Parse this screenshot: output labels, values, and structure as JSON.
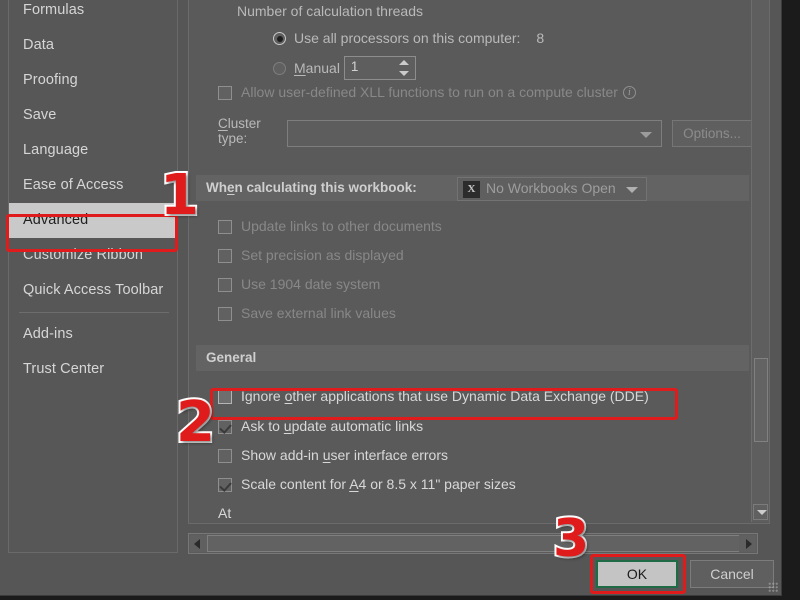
{
  "dialog": {
    "nav": {
      "items": [
        {
          "label": "Formulas",
          "selected": false
        },
        {
          "label": "Data",
          "selected": false
        },
        {
          "label": "Proofing",
          "selected": false
        },
        {
          "label": "Save",
          "selected": false
        },
        {
          "label": "Language",
          "selected": false
        },
        {
          "label": "Ease of Access",
          "selected": false
        },
        {
          "label": "Advanced",
          "selected": true
        },
        {
          "label": "Customize Ribbon",
          "selected": false
        },
        {
          "label": "Quick Access Toolbar",
          "selected": false
        },
        {
          "label": "Add-ins",
          "selected": false
        },
        {
          "label": "Trust Center",
          "selected": false
        }
      ]
    },
    "formulas_section": {
      "threads_label": "Number of calculation threads",
      "use_all_processors_label": "Use all processors on this computer:",
      "use_all_processors_count": "8",
      "use_all_processors_selected": true,
      "manual_label": "Manual",
      "manual_selected": false,
      "manual_value": "1",
      "allow_xll_label": "Allow user-defined XLL functions to run on a compute cluster",
      "allow_xll_checked": false,
      "info_icon": "info-circle-icon",
      "cluster_type_label_line1": "Cluster",
      "cluster_type_label_line2": "type:",
      "cluster_type_value": "",
      "options_button_label": "Options..."
    },
    "workbook_section": {
      "header": "When calculating this workbook:",
      "workbook_selector_value": "No Workbooks Open",
      "workbook_icon": "excel-file-icon",
      "checkboxes": [
        {
          "label": "Update links to other documents",
          "checked": false
        },
        {
          "label": "Set precision as displayed",
          "checked": false
        },
        {
          "label": "Use 1904 date system",
          "checked": false
        },
        {
          "label": "Save external link values",
          "checked": false
        }
      ]
    },
    "general_section": {
      "header": "General",
      "checkboxes": [
        {
          "label": "Ignore other applications that use Dynamic Data Exchange (DDE)",
          "checked": false,
          "highlighted": true
        },
        {
          "label": "Ask to update automatic links",
          "checked": true,
          "highlighted": false
        },
        {
          "label": "Show add-in user interface errors",
          "checked": false,
          "highlighted": false
        },
        {
          "label": "Scale content for A4 or 8.5 x 11\" paper sizes",
          "checked": true,
          "highlighted": false
        }
      ],
      "trailing_label": "At"
    },
    "footer": {
      "ok_label": "OK",
      "cancel_label": "Cancel"
    },
    "scrollbars": {
      "vertical_down_icon": "triangle-down-icon",
      "horizontal_left_icon": "triangle-left-icon",
      "horizontal_right_icon": "triangle-right-icon"
    }
  },
  "annotations": {
    "accent_color": "#e01b1b",
    "steps": [
      {
        "number": "1",
        "target": "Advanced"
      },
      {
        "number": "2",
        "target": "Ignore other applications that use Dynamic Data Exchange (DDE)"
      },
      {
        "number": "3",
        "target": "OK"
      }
    ]
  }
}
